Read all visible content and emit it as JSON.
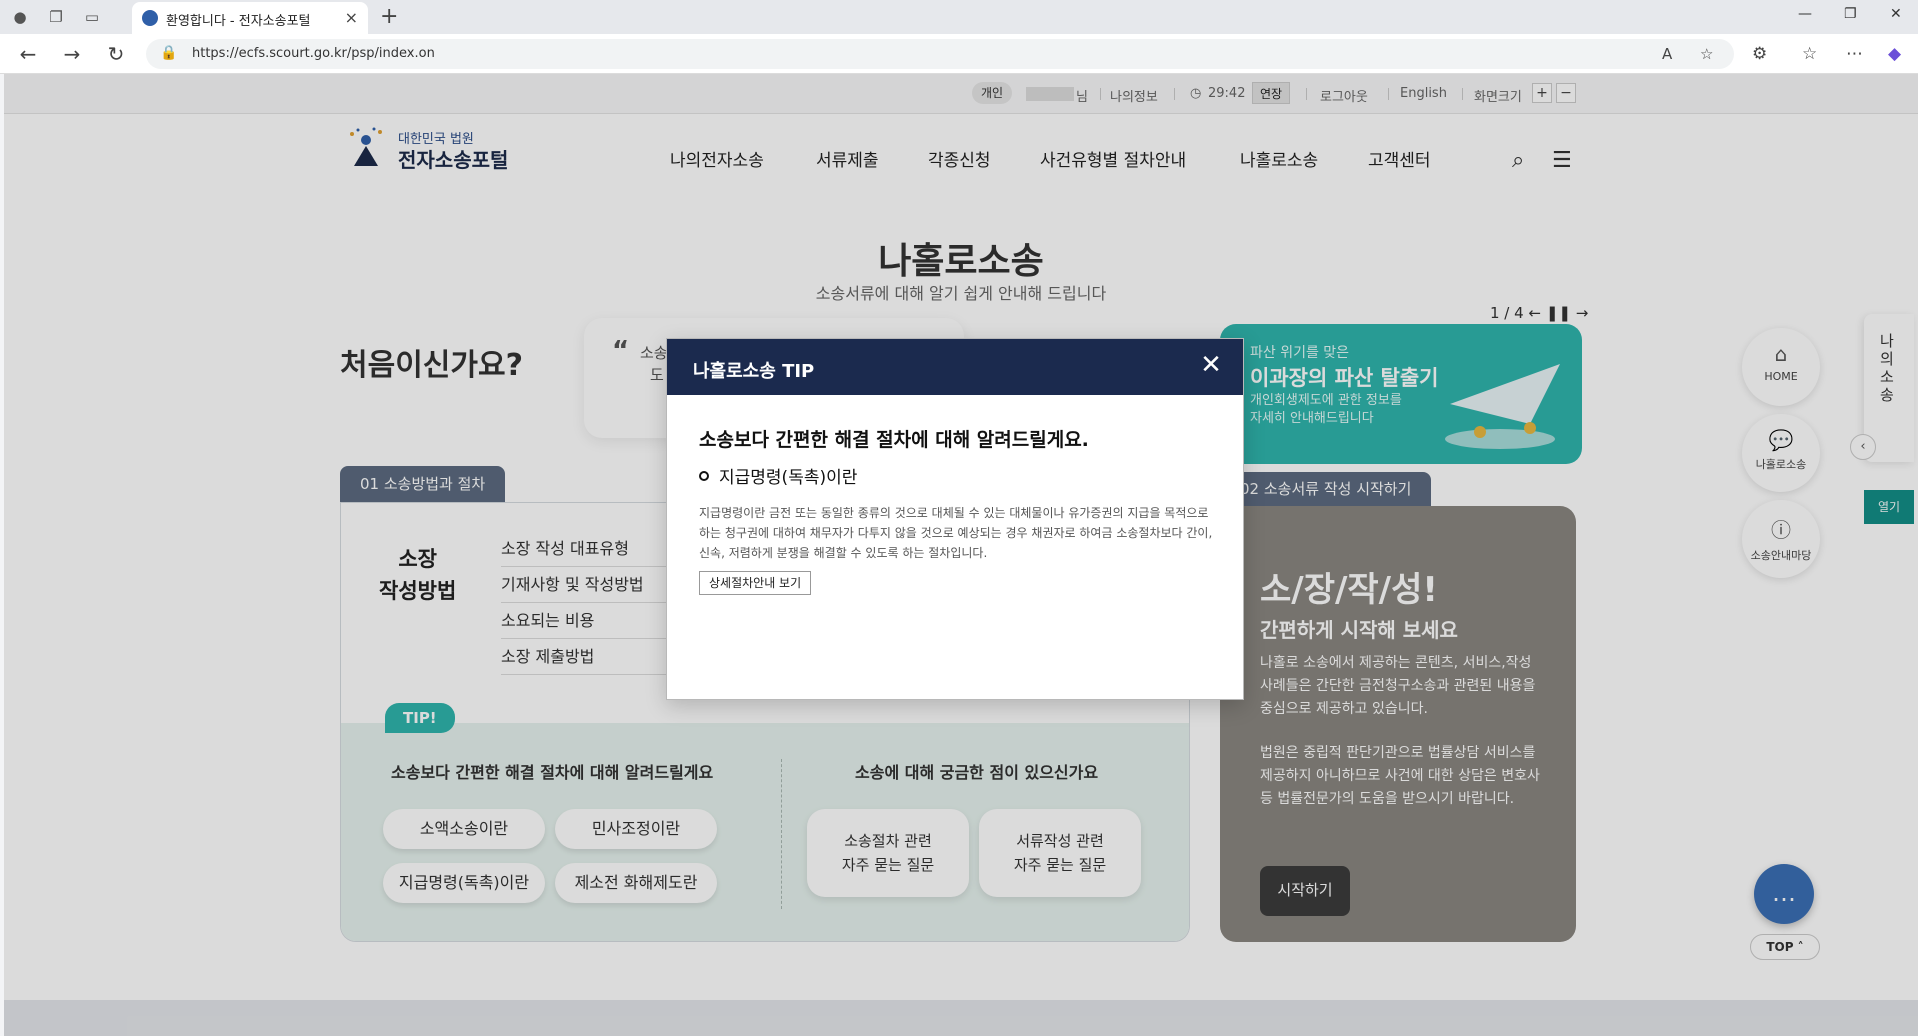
{
  "browser": {
    "tab_title": "환영합니다 - 전자소송포털",
    "url": "https://ecfs.scourt.go.kr/psp/index.on"
  },
  "utilbar": {
    "badge": "개인",
    "user_suffix": "님",
    "my_info": "나의정보",
    "timer": "29:42",
    "extend": "연장",
    "logout": "로그아웃",
    "english": "English",
    "zoom_label": "화면크기",
    "zoom_in": "+",
    "zoom_out": "−"
  },
  "header": {
    "logo_sub": "대한민국 법원",
    "logo_main": "전자소송포털",
    "nav": [
      "나의전자소송",
      "서류제출",
      "각종신청",
      "사건유형별 절차안내",
      "나홀로소송",
      "고객센터"
    ]
  },
  "section": {
    "title": "나홀로소송",
    "subtitle": "소송서류에 대해 알기 쉽게 안내해 드립니다"
  },
  "first": {
    "question": "처음이신가요?",
    "quote_text_1": "소송",
    "quote_text_2": "도"
  },
  "banner": {
    "slide_counter": "1 / 4",
    "line1": "파산 위기를 맞은",
    "line2": "이과장의 파산 탈출기",
    "line3": "개인회생제도에 관한 정보를",
    "line4": "자세히 안내해드립니다"
  },
  "section1": {
    "tab": "01  소송방법과 절차",
    "head_line1": "소장",
    "head_line2": "작성방법",
    "items": [
      "소장 작성 대표유형",
      "기재사항 및 작성방법",
      "소요되는 비용",
      "소장 제출방법"
    ],
    "tip_badge": "TIP!",
    "tip_left_title": "소송보다 간편한 해결 절차에 대해 알려드릴게요",
    "tip_right_title": "소송에 대해 궁금한 점이 있으신가요",
    "pills": [
      "소액소송이란",
      "민사조정이란",
      "지급명령(독촉)이란",
      "제소전 화해제도란"
    ],
    "faq": [
      {
        "line1": "소송절차 관련",
        "line2": "자주 묻는 질문"
      },
      {
        "line1": "서류작성 관련",
        "line2": "자주 묻는 질문"
      }
    ]
  },
  "section2": {
    "tab": "02  소송서류 작성 시작하기",
    "title": "소/장/작/성!",
    "subtitle": "간편하게 시작해 보세요",
    "para1": "나홀로 소송에서 제공하는 콘텐츠, 서비스,작성사례들은 간단한 금전청구소송과 관련된 내용을 중심으로 제공하고 있습니다.",
    "para2": "법원은 중립적 판단기관으로 법률상담 서비스를 제공하지 아니하므로 사건에 대한 상담은 변호사 등 법률전문가의 도움을 받으시기 바랍니다.",
    "start": "시작하기"
  },
  "side": {
    "home": "HOME",
    "alone": "나홀로소송",
    "guide": "소송안내마당",
    "quick": "나의소송",
    "open": "열기",
    "top": "TOP"
  },
  "modal": {
    "title": "나홀로소송 TIP",
    "heading": "소송보다 간편한 해결 절차에 대해 알려드릴게요.",
    "subheading": "지급명령(독촉)이란",
    "body": "지급명령이란 금전 또는 동일한 종류의 것으로 대체될 수 있는 대체물이나 유가증권의 지급을 목적으로 하는 청구권에 대하여 채무자가 다투지 않을 것으로 예상되는 경우 채권자로 하여금 소송절차보다 간이, 신속, 저렴하게 분쟁을 해결할 수 있도록 하는 절차입니다.",
    "button": "상세절차안내 보기",
    "close_glyph": "✕"
  }
}
